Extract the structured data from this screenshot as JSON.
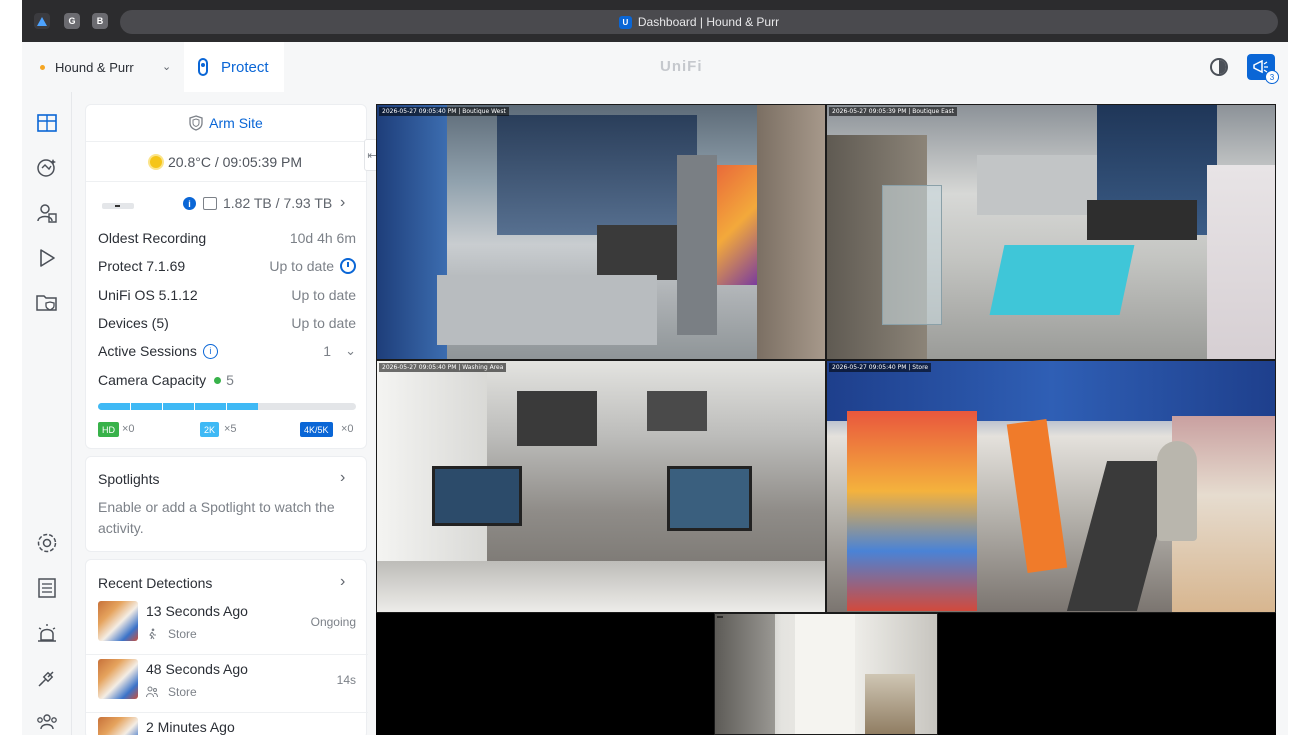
{
  "browser": {
    "tab_favicons": [
      "G",
      "B"
    ],
    "page_title": "Dashboard | Hound & Purr"
  },
  "header": {
    "site_name": "Hound & Purr",
    "app_tab": "Protect",
    "logo": "UniFi",
    "notification_count": "3"
  },
  "nav": {
    "icons": [
      "dashboard-icon",
      "ai-detections-icon",
      "alarm-manager-icon",
      "play-icon",
      "files-shield-icon",
      "settings-icon",
      "reports-icon",
      "alerts-icon",
      "integrations-icon",
      "users-icon"
    ]
  },
  "panel": {
    "arm_site": "Arm Site",
    "weather": "20.8°C / 09:05:39 PM",
    "storage": "1.82 TB / 7.93 TB",
    "rows": [
      {
        "label": "Oldest Recording",
        "value": "10d 4h 6m"
      },
      {
        "label": "Protect 7.1.69",
        "value": "Up to date"
      },
      {
        "label": "UniFi OS 5.1.12",
        "value": "Up to date"
      },
      {
        "label": "Devices (5)",
        "value": "Up to date"
      },
      {
        "label": "Active Sessions",
        "value": "1"
      },
      {
        "label": "Camera Capacity",
        "value": "5"
      }
    ],
    "capacity_fraction": 0.62,
    "resolutions": [
      {
        "badge": "HD",
        "count": "×0",
        "color": "#38b24a"
      },
      {
        "badge": "2K",
        "count": "×5",
        "color": "#3fb9f5"
      },
      {
        "badge": "4K/5K",
        "count": "×0",
        "color": "#0a66d6"
      }
    ]
  },
  "spotlights": {
    "title": "Spotlights",
    "description": "Enable or add a Spotlight to watch the activity."
  },
  "detections": {
    "title": "Recent Detections",
    "items": [
      {
        "time": "13 Seconds Ago",
        "location": "Store",
        "duration": "Ongoing",
        "icon": "person-walking-icon"
      },
      {
        "time": "48 Seconds Ago",
        "location": "Store",
        "duration": "14s",
        "icon": "people-icon"
      },
      {
        "time": "2 Minutes Ago",
        "location": "",
        "duration": "",
        "icon": ""
      }
    ]
  },
  "cameras": [
    {
      "label": "2026-05-27 09:05:40 PM | Boutique West"
    },
    {
      "label": "2026-05-27 09:05:39 PM | Boutique East"
    },
    {
      "label": "2026-05-27 09:05:40 PM | Washing Area"
    },
    {
      "label": "2026-05-27 09:05:40 PM | Store"
    },
    {
      "label": ""
    }
  ]
}
